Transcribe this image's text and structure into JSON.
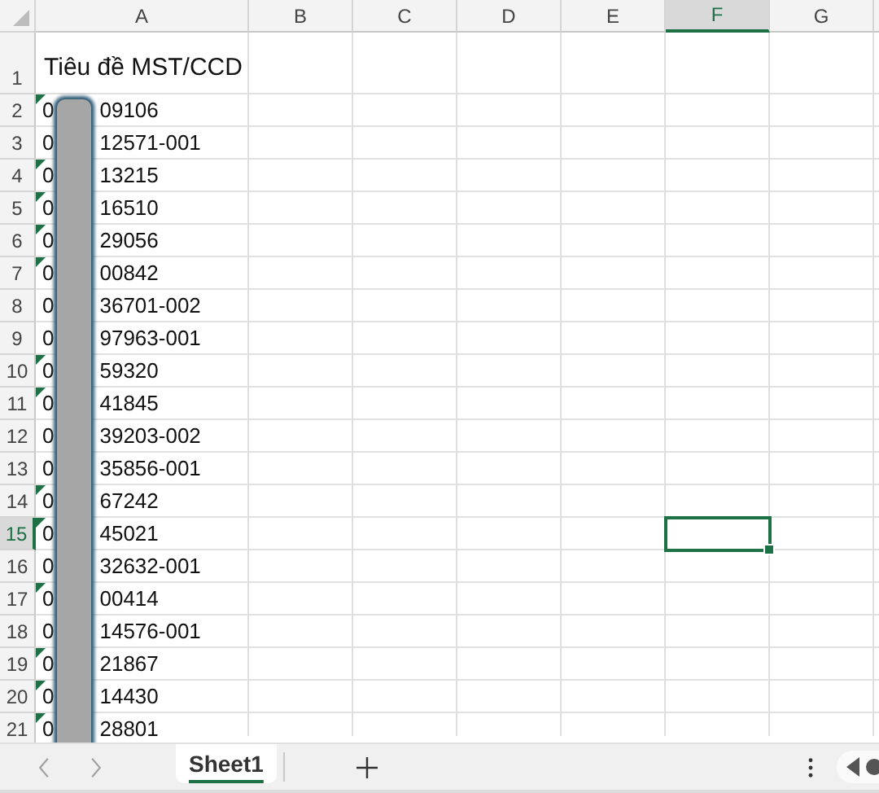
{
  "columns": [
    {
      "label": "A",
      "selected": false
    },
    {
      "label": "B",
      "selected": false
    },
    {
      "label": "C",
      "selected": false
    },
    {
      "label": "D",
      "selected": false
    },
    {
      "label": "E",
      "selected": false
    },
    {
      "label": "F",
      "selected": true
    },
    {
      "label": "G",
      "selected": false
    }
  ],
  "header_row": {
    "number": "1",
    "selected": false,
    "title": "Tiêu đề MST/CCD"
  },
  "rows": [
    {
      "number": "2",
      "selected": false,
      "prefix": "0",
      "suffix": "09106",
      "flag": true
    },
    {
      "number": "3",
      "selected": false,
      "prefix": "0",
      "suffix": "12571-001",
      "flag": false
    },
    {
      "number": "4",
      "selected": false,
      "prefix": "0",
      "suffix": "13215",
      "flag": true
    },
    {
      "number": "5",
      "selected": false,
      "prefix": "0",
      "suffix": "16510",
      "flag": true
    },
    {
      "number": "6",
      "selected": false,
      "prefix": "0",
      "suffix": "29056",
      "flag": true
    },
    {
      "number": "7",
      "selected": false,
      "prefix": "0",
      "suffix": "00842",
      "flag": true
    },
    {
      "number": "8",
      "selected": false,
      "prefix": "0",
      "suffix": "36701-002",
      "flag": false
    },
    {
      "number": "9",
      "selected": false,
      "prefix": "0",
      "suffix": "97963-001",
      "flag": false
    },
    {
      "number": "10",
      "selected": false,
      "prefix": "0",
      "suffix": "59320",
      "flag": true
    },
    {
      "number": "11",
      "selected": false,
      "prefix": "0",
      "suffix": "41845",
      "flag": true
    },
    {
      "number": "12",
      "selected": false,
      "prefix": "0",
      "suffix": "39203-002",
      "flag": false
    },
    {
      "number": "13",
      "selected": false,
      "prefix": "0",
      "suffix": "35856-001",
      "flag": false
    },
    {
      "number": "14",
      "selected": false,
      "prefix": "0",
      "suffix": "67242",
      "flag": true
    },
    {
      "number": "15",
      "selected": true,
      "prefix": "0",
      "suffix": "45021",
      "flag": true
    },
    {
      "number": "16",
      "selected": false,
      "prefix": "0",
      "suffix": "32632-001",
      "flag": false
    },
    {
      "number": "17",
      "selected": false,
      "prefix": "0",
      "suffix": "00414",
      "flag": true
    },
    {
      "number": "18",
      "selected": false,
      "prefix": "0",
      "suffix": "14576-001",
      "flag": false
    },
    {
      "number": "19",
      "selected": false,
      "prefix": "0",
      "suffix": "21867",
      "flag": true
    },
    {
      "number": "20",
      "selected": false,
      "prefix": "0",
      "suffix": "14430",
      "flag": true
    },
    {
      "number": "21",
      "selected": false,
      "prefix": "0",
      "suffix": "28801",
      "flag": true
    }
  ],
  "sheet_tabs": [
    {
      "label": "Sheet1",
      "selected": true
    }
  ]
}
